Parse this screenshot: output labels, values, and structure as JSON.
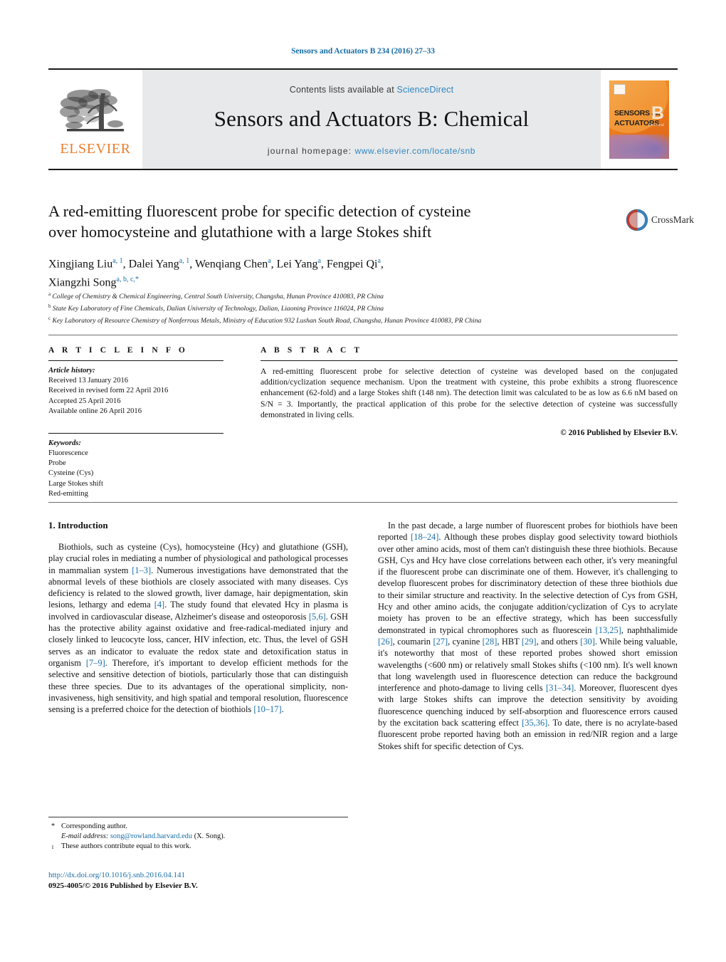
{
  "running_head": "Sensors and Actuators B 234 (2016) 27–33",
  "masthead": {
    "publisher": "ELSEVIER",
    "contents_prefix": "Contents lists available at ",
    "contents_link": "ScienceDirect",
    "journal_title": "Sensors and Actuators B: Chemical",
    "homepage_prefix": "journal homepage: ",
    "homepage_url": "www.elsevier.com/locate/snb",
    "cover": {
      "line1": "SENSORS",
      "and": "and",
      "line2": "ACTUATORS",
      "letter": "B",
      "sub": "Chemical"
    }
  },
  "article": {
    "title_line1": "A red-emitting fluorescent probe for specific detection of cysteine",
    "title_line2": "over homocysteine and glutathione with a large Stokes shift",
    "crossmark_label": "CrossMark",
    "authors": [
      {
        "name": "Xingjiang Liu",
        "sup": "a, 1",
        "sep": ", "
      },
      {
        "name": "Dalei Yang",
        "sup": "a, 1",
        "sep": ", "
      },
      {
        "name": "Wenqiang Chen",
        "sup": "a",
        "sep": ", "
      },
      {
        "name": "Lei Yang",
        "sup": "a",
        "sep": ", "
      },
      {
        "name": "Fengpei Qi",
        "sup": "a",
        "sep": ", "
      },
      {
        "name": "Xiangzhi Song",
        "sup": "a, b, c,",
        "sep": ""
      }
    ],
    "affiliations": [
      {
        "mark": "a",
        "text": "College of Chemistry & Chemical Engineering, Central South University, Changsha, Hunan Province 410083, PR China"
      },
      {
        "mark": "b",
        "text": "State Key Laboratory of Fine Chemicals, Dalian University of Technology, Dalian, Liaoning Province 116024, PR China"
      },
      {
        "mark": "c",
        "text": "Key Laboratory of Resource Chemistry of Nonferrous Metals, Ministry of Education 932 Lushan South Road, Changsha, Hunan Province 410083, PR China"
      }
    ]
  },
  "article_info": {
    "heading": "A R T I C L E    I N F O",
    "history_label": "Article history:",
    "history": [
      "Received 13 January 2016",
      "Received in revised form 22 April 2016",
      "Accepted 25 April 2016",
      "Available online 26 April 2016"
    ],
    "keywords_label": "Keywords:",
    "keywords": [
      "Fluorescence",
      "Probe",
      "Cysteine (Cys)",
      "Large Stokes shift",
      "Red-emitting"
    ]
  },
  "abstract": {
    "heading": "A B S T R A C T",
    "text": "A red-emitting fluorescent probe for selective detection of cysteine was developed based on the conjugated addition/cyclization sequence mechanism. Upon the treatment with cysteine, this probe exhibits a strong fluorescence enhancement (62-fold) and a large Stokes shift (148 nm). The detection limit was calculated to be as low as 6.6 nM based on S/N = 3. Importantly, the practical application of this probe for the selective detection of cysteine was successfully demonstrated in living cells.",
    "copyright": "© 2016 Published by Elsevier B.V."
  },
  "body": {
    "section_title": "1.  Introduction",
    "left_paragraph": "Biothiols, such as cysteine (Cys), homocysteine (Hcy) and glutathione (GSH), play crucial roles in mediating a number of physiological and pathological processes in mammalian system [1–3]. Numerous investigations have demonstrated that the abnormal levels of these biothiols are closely associated with many diseases. Cys deficiency is related to the slowed growth, liver damage, hair depigmentation, skin lesions, lethargy and edema [4]. The study found that elevated Hcy in plasma is involved in cardiovascular disease, Alzheimer's disease and osteoporosis [5,6]. GSH has the protective ability against oxidative and free-radical-mediated injury and closely linked to leucocyte loss, cancer, HIV infection, etc. Thus, the level of GSH serves as an indicator to evaluate the redox state and detoxification status in organism [7–9]. Therefore, it's important to develop efficient methods for the selective and sensitive detection of biotiols, particularly those that can distinguish these three species. Due to its advantages of the operational simplicity, non-invasiveness, high sensitivity, and high spatial and temporal resolution, fluorescence sensing is a preferred choice for the detection of biothiols [10–17].",
    "right_paragraph": "In the past decade, a large number of fluorescent probes for biothiols have been reported [18–24]. Although these probes display good selectivity toward biothiols over other amino acids, most of them can't distinguish these three biothiols. Because GSH, Cys and Hcy have close correlations between each other, it's very meaningful if the fluorescent probe can discriminate one of them. However, it's challenging to develop fluorescent probes for discriminatory detection of these three biothiols due to their similar structure and reactivity. In the selective detection of Cys from GSH, Hcy and other amino acids, the conjugate addition/cyclization of Cys to acrylate moiety has proven to be an effective strategy, which has been successfully demonstrated in typical chromophores such as fluorescein [13,25], naphthalimide [26], coumarin [27], cyanine [28], HBT [29], and others [30]. While being valuable, it's noteworthy that most of these reported probes showed short emission wavelengths (<600 nm) or relatively small Stokes shifts (<100 nm). It's well known that long wavelength used in fluorescence detection can reduce the background interference and photo-damage to living cells [31–34]. Moreover, fluorescent dyes with large Stokes shifts can improve the detection sensitivity by avoiding fluorescence quenching induced by self-absorption and fluorescence errors caused by the excitation back scattering effect [35,36]. To date, there is no acrylate-based fluorescent probe reported having both an emission in red/NIR region and a large Stokes shift for specific detection of Cys."
  },
  "footnotes": {
    "corresponding_mark": "*",
    "corresponding_text": "Corresponding author.",
    "email_label": "E-mail address:",
    "email": "song@rowland.harvard.edu",
    "email_suffix": "(X. Song).",
    "equal_mark": "1",
    "equal_text": "These authors contribute equal to this work."
  },
  "doi_block": {
    "doi": "http://dx.doi.org/10.1016/j.snb.2016.04.141",
    "issn": "0925-4005/© 2016 Published by Elsevier B.V."
  },
  "colors": {
    "link_blue": "#1a6ea8",
    "sd_blue": "#2e86c1",
    "elsevier_orange": "#ec7d2d"
  }
}
